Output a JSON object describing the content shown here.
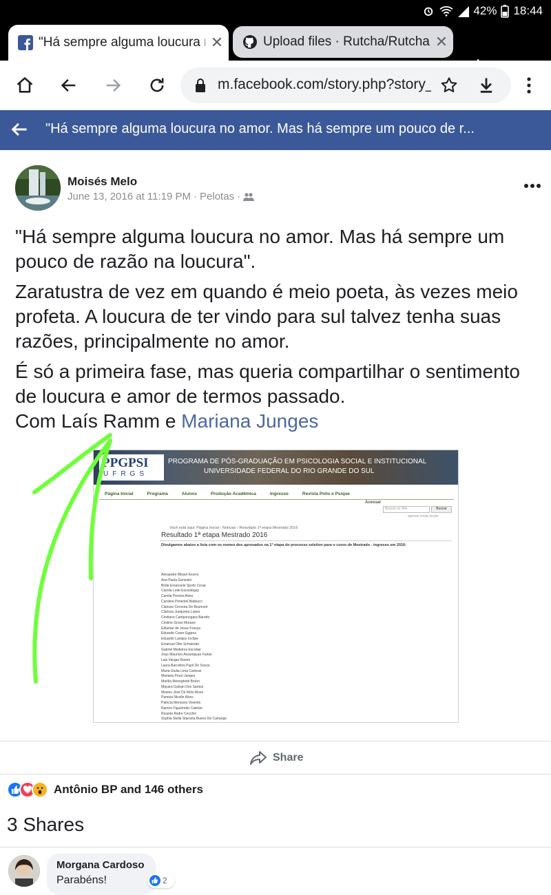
{
  "status_bar": {
    "battery": "42%",
    "time": "18:44"
  },
  "tabs": [
    {
      "title": "\"Há sempre alguma loucura no amor",
      "active": true
    },
    {
      "title": "Upload files · Rutcha/Rutcha",
      "active": false
    }
  ],
  "toolbar": {
    "url": "m.facebook.com/story.php?story_fbid"
  },
  "fb_header": {
    "title": "\"Há sempre alguma loucura no amor. Mas há sempre um pouco de r..."
  },
  "post": {
    "author": "Moisés Melo",
    "date": "June 13, 2016 at 11:19 PM",
    "location": "Pelotas",
    "p1": "\"Há sempre alguma loucura no amor. Mas há sempre um pouco de razão na loucura\".",
    "p2": "Zaratustra de vez em quando é meio poeta, às vezes meio profeta. A loucura de ter vindo para sul talvez tenha suas razões, principalmente no amor.",
    "p3": "É só a primeira fase, mas queria compartilhar o sentimento de loucura e amor de termos passado.",
    "with_prefix": "Com Laís Ramm e ",
    "tagged_link": "Mariana Junges"
  },
  "screenshot": {
    "logo": "PPGPSI",
    "logo_sub": "UFRGS",
    "banner_line1": "PROGRAMA DE PÓS-GRADUAÇÃO EM PSICOLOGIA SOCIAL E INSTITUCIONAL",
    "banner_line2": "UNIVERSIDADE FEDERAL DO RIO GRANDE DO SUL",
    "nav": [
      "Página Inicial",
      "Programa",
      "Alunos",
      "Produção Acadêmica",
      "Ingresso",
      "Revista Polis e Psique"
    ],
    "acessar": "Acessar",
    "search_placeholder": "Buscar no Site",
    "search_button": "Buscar",
    "search_option": "apenas nesta seção",
    "breadcrumb": "Você está aqui: Página Inicial › Notícias › Resultado 1ª etapa Mestrado 2016",
    "heading": "Resultado 1ª etapa Mestrado 2016",
    "intro": "Divulgamos abaixo a lista com os nomes dos aprovados na 1ª etapa do processo seletivo para o curso de Mestrado - ingresso em 2016:",
    "names": [
      "Alexandre Missel Knorre",
      "Ana Paula Genesini",
      "Bride Emanoele Spohr Cezar",
      "Camila Leite Escosteguy",
      "Camila Pereira Alves",
      "Caroline Pimentel Batitucci",
      "Clarisse Cerveira De Beumont",
      "Clarissa Junqueira Lopes",
      "Cristiane Camponogara Baretto",
      "Cristine Gross Moraes",
      "Edlamar de Jesus França",
      "Eduardo Coser Eggres",
      "Eduardo Lavigoy Iochpe",
      "Emanuel Otto Schwieder",
      "Gabriel Medeiros Escobar",
      "Joao Mauricio Assumpçao Farias",
      "Lais Vargas Ramm",
      "Laura Barcellos Pujol De Souza",
      "Maria Giulia Lima Carlessi",
      "Mariana Pozzi Junges",
      "Marília Meneghetti Bruhn",
      "Mayara Galvan Dos Santos",
      "Moisés José De Melo Alves",
      "Pamela Nicolle Alves",
      "Patricia Menezes Visentin",
      "Ramiro Figueiredo Catelan",
      "Ricardo Andre Cecchin",
      "Sophia Stella Starosta Bueno De Camargo"
    ]
  },
  "actions": {
    "share_label": "Share"
  },
  "reactions": {
    "summary": "Antônio BP and 146 others",
    "icons": [
      "like-icon",
      "love-icon",
      "wow-icon"
    ]
  },
  "shares_count": "3 Shares",
  "comment": {
    "author": "Morgana Cardoso",
    "text": "Parabéns!",
    "likes": "2"
  },
  "colors": {
    "facebook_blue": "#3b5998",
    "link": "#4b67a1",
    "arrow": "#6fff3a"
  }
}
